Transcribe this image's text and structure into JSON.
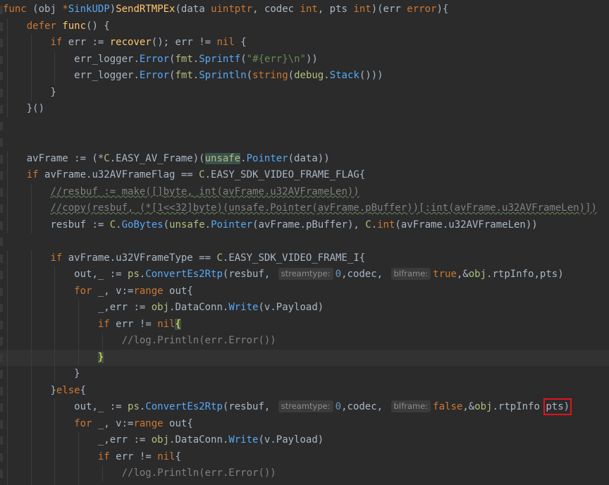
{
  "lines": [
    {
      "tokens": [
        [
          "kw",
          "func "
        ],
        [
          "ident",
          "(obj "
        ],
        [
          "kw",
          "*"
        ],
        [
          "call",
          "SinkUDP"
        ],
        [
          "ident",
          ")"
        ],
        [
          "fn",
          "SendRTMPEx"
        ],
        [
          "ident",
          "(data "
        ],
        [
          "kw",
          "uintptr"
        ],
        [
          "ident",
          ", codec "
        ],
        [
          "kw",
          "int"
        ],
        [
          "ident",
          ", pts "
        ],
        [
          "kw",
          "int"
        ],
        [
          "ident",
          ")(err "
        ],
        [
          "kw",
          "error"
        ],
        [
          "ident",
          ")"
        ],
        [
          "ident",
          "{"
        ]
      ]
    },
    {
      "tokens": [
        [
          "kw",
          "defer "
        ],
        [
          "fn",
          "func"
        ],
        [
          "ident",
          "() {"
        ]
      ]
    },
    {
      "tokens": [
        [
          "kw",
          "if "
        ],
        [
          "ident",
          "err := "
        ],
        [
          "fn",
          "recover"
        ],
        [
          "ident",
          "(); err != "
        ],
        [
          "kw",
          "nil"
        ],
        [
          "ident",
          " {"
        ]
      ]
    },
    {
      "tokens": [
        [
          "ident",
          "err_logger."
        ],
        [
          "call",
          "Error"
        ],
        [
          "ident",
          "("
        ],
        [
          "pkg",
          "fmt"
        ],
        [
          "ident",
          "."
        ],
        [
          "call",
          "Sprintf"
        ],
        [
          "ident",
          "("
        ],
        [
          "str",
          "\"#{err}\\n\""
        ],
        [
          "ident",
          "))"
        ]
      ]
    },
    {
      "tokens": [
        [
          "ident",
          "err_logger."
        ],
        [
          "call",
          "Error"
        ],
        [
          "ident",
          "("
        ],
        [
          "pkg",
          "fmt"
        ],
        [
          "ident",
          "."
        ],
        [
          "call",
          "Sprintln"
        ],
        [
          "ident",
          "("
        ],
        [
          "kw",
          "string"
        ],
        [
          "ident",
          "("
        ],
        [
          "pkg",
          "debug"
        ],
        [
          "ident",
          "."
        ],
        [
          "call",
          "Stack"
        ],
        [
          "ident",
          "()))"
        ]
      ]
    },
    {
      "tokens": [
        [
          "ident",
          "}"
        ]
      ]
    },
    {
      "tokens": [
        [
          "ident",
          "}()"
        ]
      ]
    },
    {
      "tokens": []
    },
    {
      "tokens": []
    },
    {
      "tokens": [
        [
          "ident",
          "avFrame := (*"
        ],
        [
          "pkg",
          "C"
        ],
        [
          "ident",
          ".EASY_AV_Frame)("
        ],
        [
          "pkg",
          "unsafe"
        ],
        [
          "ident",
          "."
        ],
        [
          "call",
          "Pointer"
        ],
        [
          "ident",
          "(data))"
        ]
      ]
    },
    {
      "tokens": [
        [
          "kw",
          "if "
        ],
        [
          "ident",
          "avFrame.u32AVFrameFlag == "
        ],
        [
          "pkg",
          "C"
        ],
        [
          "ident",
          ".EASY_SDK_VIDEO_FRAME_FLAG{"
        ]
      ]
    },
    {
      "tokens": [
        [
          "cmt",
          "//resbuf := make([]byte, int(avFrame.u32AVFrameLen))"
        ]
      ]
    },
    {
      "tokens": [
        [
          "cmt",
          "//copy(resbuf, (*[1<<32]byte)(unsafe.Pointer(avFrame.pBuffer))[:int(avFrame.u32AVFrameLen)])"
        ]
      ]
    },
    {
      "tokens": [
        [
          "ident",
          "resbuf := "
        ],
        [
          "pkg",
          "C"
        ],
        [
          "ident",
          "."
        ],
        [
          "call",
          "GoBytes"
        ],
        [
          "ident",
          "("
        ],
        [
          "pkg",
          "unsafe"
        ],
        [
          "ident",
          "."
        ],
        [
          "call",
          "Pointer"
        ],
        [
          "ident",
          "(avFrame.pBuffer), "
        ],
        [
          "pkg",
          "C"
        ],
        [
          "ident",
          "."
        ],
        [
          "kw",
          "int"
        ],
        [
          "ident",
          "(avFrame.u32AVFrameLen))"
        ]
      ]
    },
    {
      "tokens": []
    },
    {
      "tokens": [
        [
          "kw",
          "if "
        ],
        [
          "ident",
          "avFrame.u32VFrameType == "
        ],
        [
          "pkg",
          "C"
        ],
        [
          "ident",
          ".EASY_SDK_VIDEO_FRAME_I{"
        ]
      ]
    },
    {
      "tokens": [
        [
          "ident",
          "out,_ := "
        ],
        [
          "pkg",
          "ps"
        ],
        [
          "ident",
          "."
        ],
        [
          "call",
          "ConvertEs2Rtp"
        ],
        [
          "ident",
          "(resbuf, "
        ],
        [
          "hint",
          "streamtype:"
        ],
        [
          "num",
          "0"
        ],
        [
          "ident",
          ",codec, "
        ],
        [
          "hint",
          "bIframe:"
        ],
        [
          "kw",
          "true"
        ],
        [
          "ident",
          ",&"
        ],
        [
          "pkg",
          "obj"
        ],
        [
          "ident",
          ".rtpInfo,pts)"
        ]
      ]
    },
    {
      "tokens": [
        [
          "kw",
          "for "
        ],
        [
          "ident",
          "_, v:="
        ],
        [
          "kw",
          "range "
        ],
        [
          "ident",
          "out{"
        ]
      ]
    },
    {
      "tokens": [
        [
          "ident",
          "_,err := "
        ],
        [
          "pkg",
          "obj"
        ],
        [
          "ident",
          ".DataConn."
        ],
        [
          "call",
          "Write"
        ],
        [
          "ident",
          "(v.Payload)"
        ]
      ]
    },
    {
      "tokens": [
        [
          "kw",
          "if "
        ],
        [
          "ident",
          "err != "
        ],
        [
          "kw",
          "nil"
        ],
        [
          "match",
          "{"
        ]
      ]
    },
    {
      "tokens": [
        [
          "cmt",
          "//log.Println(err.Error())"
        ]
      ]
    },
    {
      "tokens": [
        [
          "match",
          "}"
        ]
      ]
    },
    {
      "tokens": [
        [
          "ident",
          "}"
        ]
      ]
    },
    {
      "tokens": [
        [
          "ident",
          "}"
        ],
        [
          "kw",
          "else"
        ],
        [
          "ident",
          "{"
        ]
      ]
    },
    {
      "tokens": [
        [
          "ident",
          "out,_ := "
        ],
        [
          "pkg",
          "ps"
        ],
        [
          "ident",
          "."
        ],
        [
          "call",
          "ConvertEs2Rtp"
        ],
        [
          "ident",
          "(resbuf, "
        ],
        [
          "hint",
          "streamtype:"
        ],
        [
          "num",
          "0"
        ],
        [
          "ident",
          ",codec, "
        ],
        [
          "hint",
          "bIframe:"
        ],
        [
          "kw",
          "false"
        ],
        [
          "ident",
          ",&"
        ],
        [
          "pkg",
          "obj"
        ],
        [
          "ident",
          ".rtpInfo "
        ],
        [
          "ident",
          "pts)"
        ]
      ]
    },
    {
      "tokens": [
        [
          "kw",
          "for "
        ],
        [
          "ident",
          "_, v:="
        ],
        [
          "kw",
          "range "
        ],
        [
          "ident",
          "out{"
        ]
      ]
    },
    {
      "tokens": [
        [
          "ident",
          "_,err := "
        ],
        [
          "pkg",
          "obj"
        ],
        [
          "ident",
          ".DataConn."
        ],
        [
          "call",
          "Write"
        ],
        [
          "ident",
          "(v.Payload)"
        ]
      ]
    },
    {
      "tokens": [
        [
          "kw",
          "if "
        ],
        [
          "ident",
          "err != "
        ],
        [
          "kw",
          "nil"
        ],
        [
          "ident",
          "{"
        ]
      ]
    },
    {
      "tokens": [
        [
          "cmt",
          "//log.Println(err.Error())"
        ]
      ]
    },
    {
      "tokens": [
        [
          "ident",
          "}"
        ]
      ]
    }
  ],
  "colors": {
    "background": "#2b2b2b",
    "highlight_box": "#e0141e"
  }
}
